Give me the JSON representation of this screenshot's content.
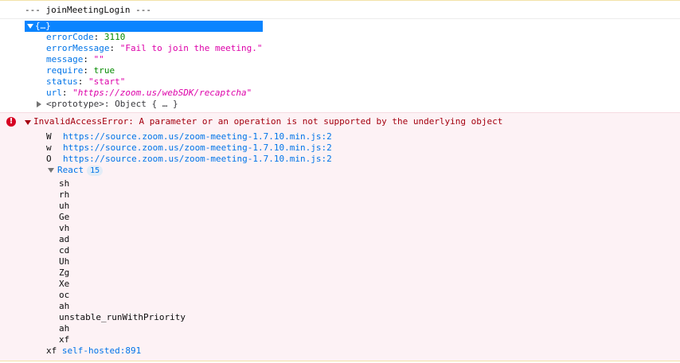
{
  "log": {
    "title": "--- joinMeetingLogin ---"
  },
  "object": {
    "label": "{…}",
    "props": [
      {
        "key": "errorCode",
        "value": "3110",
        "kind": "num"
      },
      {
        "key": "errorMessage",
        "value": "\"Fail to join the meeting.\"",
        "kind": "str"
      },
      {
        "key": "message",
        "value": "\"\"",
        "kind": "str"
      },
      {
        "key": "require",
        "value": "true",
        "kind": "bool"
      },
      {
        "key": "status",
        "value": "\"start\"",
        "kind": "str"
      },
      {
        "key": "url",
        "value": "\"https://zoom.us/webSDK/recaptcha\"",
        "kind": "url"
      }
    ],
    "prototype": "<prototype>: Object { … }"
  },
  "error": {
    "icon": "!",
    "message": "InvalidAccessError: A parameter or an operation is not supported by the underlying object",
    "frames": [
      {
        "fn": "W",
        "loc": "https://source.zoom.us/zoom-meeting-1.7.10.min.js:2"
      },
      {
        "fn": "w",
        "loc": "https://source.zoom.us/zoom-meeting-1.7.10.min.js:2"
      },
      {
        "fn": "O",
        "loc": "https://source.zoom.us/zoom-meeting-1.7.10.min.js:2"
      }
    ],
    "group": {
      "name": "React",
      "count": "15",
      "frames": [
        "sh",
        "rh",
        "uh",
        "Ge",
        "vh",
        "ad",
        "cd",
        "Uh",
        "Zg",
        "Xe",
        "oc",
        "ah",
        "unstable_runWithPriority",
        "ah",
        "xf"
      ]
    },
    "last_frame": {
      "fn": "xf",
      "loc": "self-hosted:891"
    }
  },
  "colors": {
    "selection": "#0a84ff",
    "error_bg": "#fdf2f5",
    "error_text": "#a4000f",
    "key": "#0074e8",
    "string": "#dd00a9",
    "number": "#058b00"
  }
}
